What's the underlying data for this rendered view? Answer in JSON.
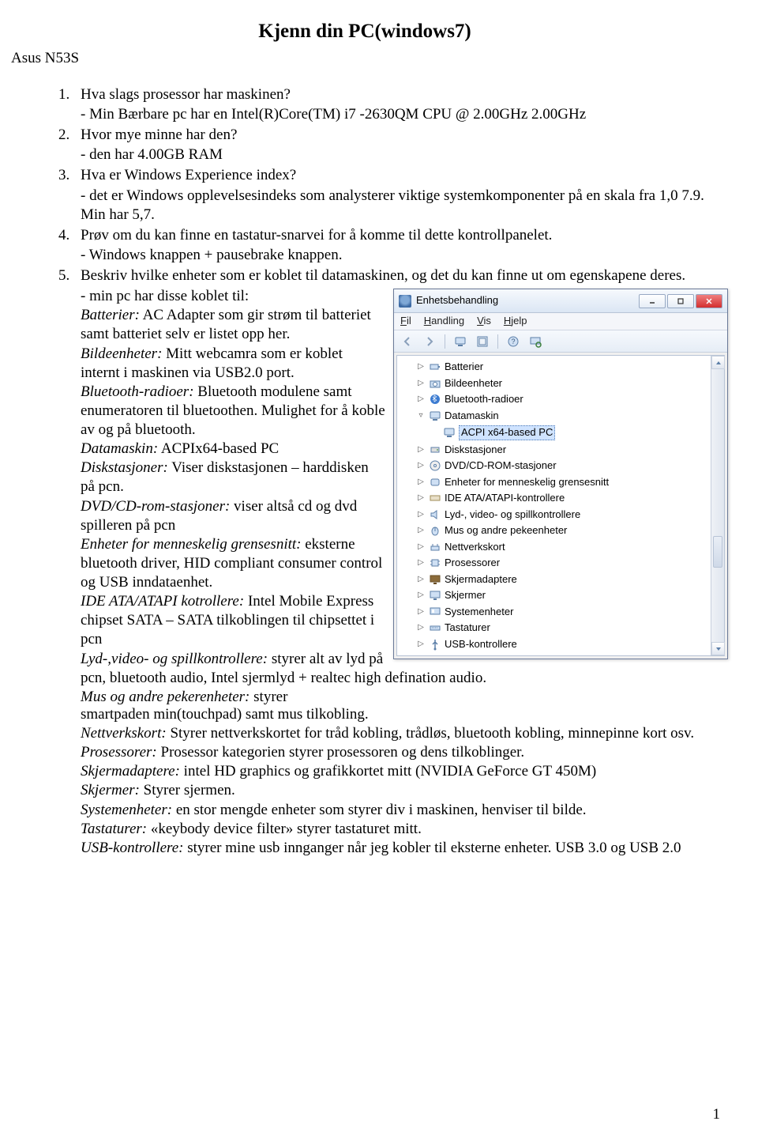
{
  "doc": {
    "title": "Kjenn din PC(windows7)",
    "subtitle": "Asus N53S",
    "page_number": "1"
  },
  "qa": {
    "q1": "Hva slags prosessor har maskinen?",
    "a1": "- Min Bærbare pc har en Intel(R)Core(TM) i7 -2630QM CPU @ 2.00GHz 2.00GHz",
    "q2": "Hvor mye minne har den?",
    "a2": "- den har 4.00GB RAM",
    "q3": "Hva er Windows Experience index?",
    "a3": "- det er Windows opplevelsesindeks som analysterer viktige systemkomponenter på en skala fra 1,0 7.9. Min har 5,7.",
    "q4": "Prøv om du kan finne en tastatur-snarvei for å komme til dette kontrollpanelet.",
    "a4": "- Windows knappen + pausebrake knappen.",
    "q5": "Beskriv hvilke enheter som er koblet til datamaskinen, og det du kan finne ut om egenskapene deres.",
    "a5_intro": "- min pc har disse koblet til:",
    "devices": {
      "batterier_lbl": "Batterier:",
      "batterier_txt": " AC Adapter som gir strøm til batteriet samt batteriet selv er listet opp her.",
      "bilde_lbl": "Bildeenheter:",
      "bilde_txt": " Mitt webcamra som er koblet internt i maskinen via USB2.0 port.",
      "bt_lbl": "Bluetooth-radioer:",
      "bt_txt": " Bluetooth modulene samt enumeratoren til bluetoothen. Mulighet for å koble av og på bluetooth.",
      "dm_lbl": "Datamaskin:",
      "dm_txt": " ACPIx64-based PC",
      "disk_lbl": "Diskstasjoner:",
      "disk_txt": " Viser diskstasjonen – harddisken på pcn.",
      "dvd_lbl": "DVD/CD-rom-stasjoner:",
      "dvd_txt": " viser altså cd og dvd spilleren på pcn",
      "hid_lbl": "Enheter for menneskelig grensesnitt:",
      "hid_txt": " eksterne bluetooth driver, HID compliant consumer control  og USB inndataenhet.",
      "ide_lbl": "IDE ATA/ATAPI kotrollere:",
      "ide_txt": " Intel Mobile Express chipset SATA – SATA tilkoblingen til chipsettet i pcn",
      "lyd_lbl": "Lyd-,video- og spillkontrollere:",
      "lyd_txt": " styrer alt av lyd på pcn, bluetooth audio, Intel sjermlyd + realtec high defination audio.",
      "mus_lbl": "Mus og andre pekerenheter:",
      "mus_txt": " styrer",
      "mus_txt2": "smartpaden min(touchpad) samt mus tilkobling.",
      "nett_lbl": "Nettverkskort:",
      "nett_txt": " Styrer nettverkskortet for tråd kobling, trådløs, bluetooth kobling, minnepinne kort osv.",
      "pros_lbl": "Prosessorer:",
      "pros_txt": " Prosessor kategorien styrer prosessoren og dens tilkoblinger.",
      "ska_lbl": "Skjermadaptere:",
      "ska_txt": " intel HD graphics og grafikkortet mitt (NVIDIA GeForce GT 450M)",
      "skj_lbl": "Skjermer:",
      "skj_txt": " Styrer sjermen.",
      "sys_lbl": "Systemenheter:",
      "sys_txt": " en stor mengde enheter som styrer div i maskinen, henviser til bilde.",
      "tas_lbl": "Tastaturer:",
      "tas_txt": " «keybody device filter» styrer tastaturet mitt.",
      "usb_lbl": "USB-kontrollere:",
      "usb_txt": " styrer mine usb innganger når jeg kobler til eksterne enheter. USB 3.0 og USB 2.0"
    }
  },
  "devmgr": {
    "title": "Enhetsbehandling",
    "menu": {
      "fil": "Fil",
      "handling": "Handling",
      "vis": "Vis",
      "hjelp": "Hjelp"
    },
    "tree": [
      {
        "lvl": 1,
        "exp": "▷",
        "icon": "battery",
        "label": "Batterier"
      },
      {
        "lvl": 1,
        "exp": "▷",
        "icon": "camera",
        "label": "Bildeenheter"
      },
      {
        "lvl": 1,
        "exp": "▷",
        "icon": "bt",
        "label": "Bluetooth-radioer"
      },
      {
        "lvl": 1,
        "exp": "▿",
        "icon": "computer",
        "label": "Datamaskin"
      },
      {
        "lvl": 2,
        "exp": "",
        "icon": "computer",
        "label": "ACPI x64-based PC",
        "selected": true
      },
      {
        "lvl": 1,
        "exp": "▷",
        "icon": "disk",
        "label": "Diskstasjoner"
      },
      {
        "lvl": 1,
        "exp": "▷",
        "icon": "dvd",
        "label": "DVD/CD-ROM-stasjoner"
      },
      {
        "lvl": 1,
        "exp": "▷",
        "icon": "hid",
        "label": "Enheter for menneskelig grensesnitt"
      },
      {
        "lvl": 1,
        "exp": "▷",
        "icon": "ide",
        "label": "IDE ATA/ATAPI-kontrollere"
      },
      {
        "lvl": 1,
        "exp": "▷",
        "icon": "sound",
        "label": "Lyd-, video- og spillkontrollere"
      },
      {
        "lvl": 1,
        "exp": "▷",
        "icon": "mouse",
        "label": "Mus og andre pekeenheter"
      },
      {
        "lvl": 1,
        "exp": "▷",
        "icon": "net",
        "label": "Nettverkskort"
      },
      {
        "lvl": 1,
        "exp": "▷",
        "icon": "cpu",
        "label": "Prosessorer"
      },
      {
        "lvl": 1,
        "exp": "▷",
        "icon": "display",
        "label": "Skjermadaptere"
      },
      {
        "lvl": 1,
        "exp": "▷",
        "icon": "monitor",
        "label": "Skjermer"
      },
      {
        "lvl": 1,
        "exp": "▷",
        "icon": "system",
        "label": "Systemenheter"
      },
      {
        "lvl": 1,
        "exp": "▷",
        "icon": "keyboard",
        "label": "Tastaturer"
      },
      {
        "lvl": 1,
        "exp": "▷",
        "icon": "usb",
        "label": "USB-kontrollere"
      }
    ]
  }
}
